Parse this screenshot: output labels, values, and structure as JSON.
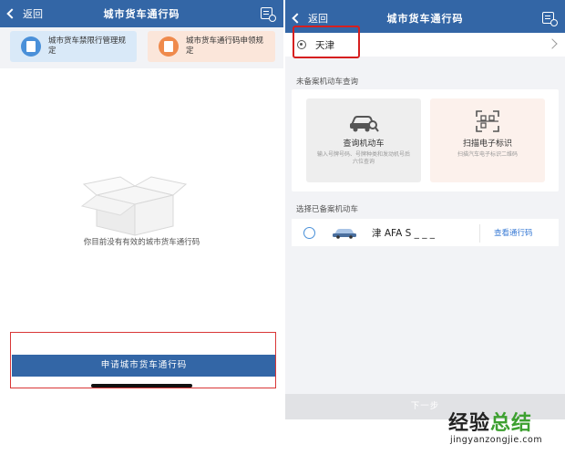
{
  "left_screen": {
    "nav": {
      "back_label": "返回",
      "title": "城市货车通行码"
    },
    "cards": [
      {
        "label": "城市货车禁限行管理规定"
      },
      {
        "label": "城市货车通行码申领规定"
      }
    ],
    "empty_message": "你目前没有有效的城市货车通行码",
    "apply_button": "申请城市货车通行码"
  },
  "right_screen": {
    "nav": {
      "back_label": "返回",
      "title": "城市货车通行码"
    },
    "city": "天津",
    "unregistered_section": "未备案机动车查询",
    "query_car": {
      "title": "查询机动车",
      "subtitle": "输入号牌号码、号牌种类和发动机号后六位查询"
    },
    "scan": {
      "title": "扫描电子标识",
      "subtitle": "扫描汽车电子标识二维码"
    },
    "registered_section": "选择已备案机动车",
    "vehicle": {
      "plate": "津 AFA S _ _ _",
      "view_label": "查看通行码"
    },
    "next_button": "下一步"
  },
  "watermark": {
    "cn_part1": "经验",
    "cn_part2": "总结",
    "en": "jingyanzongjie.com"
  },
  "colors": {
    "nav": "#3366a6",
    "highlight_box": "#d61f1f",
    "link": "#3a7bd5",
    "card_blue": "#d9e9f8",
    "card_orange": "#fbe6da"
  }
}
